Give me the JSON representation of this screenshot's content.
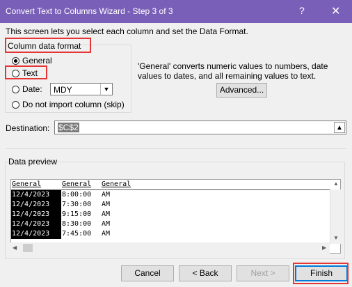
{
  "window": {
    "title": "Convert Text to Columns Wizard - Step 3 of 3",
    "help_label": "?",
    "close_label": "✕"
  },
  "description": "This screen lets you select each column and set the Data Format.",
  "column_format": {
    "group_title": "Column data format",
    "options": [
      {
        "label": "General",
        "selected": true
      },
      {
        "label": "Text",
        "selected": false
      },
      {
        "label": "Date:",
        "selected": false
      },
      {
        "label": "Do not import column (skip)",
        "selected": false
      }
    ],
    "date_format_value": "MDY"
  },
  "info_text": "'General' converts numeric values to numbers, date values to dates, and all remaining values to text.",
  "advanced_button": "Advanced...",
  "destination": {
    "label": "Destination:",
    "value": "$C$2"
  },
  "preview": {
    "label": "Data preview",
    "headers": [
      "General",
      "General",
      "General"
    ],
    "rows": [
      [
        "12/4/2023",
        "8:00:00",
        "AM"
      ],
      [
        "12/4/2023",
        "7:30:00",
        "AM"
      ],
      [
        "12/4/2023",
        "9:15:00",
        "AM"
      ],
      [
        "12/4/2023",
        "8:30:00",
        "AM"
      ],
      [
        "12/4/2023",
        "7:45:00",
        "AM"
      ]
    ]
  },
  "buttons": {
    "cancel": "Cancel",
    "back": "< Back",
    "next": "Next >",
    "finish": "Finish"
  },
  "colors": {
    "title_bar": "#7a5fb8",
    "highlight": "#e53535",
    "default_button_border": "#0078d7"
  }
}
